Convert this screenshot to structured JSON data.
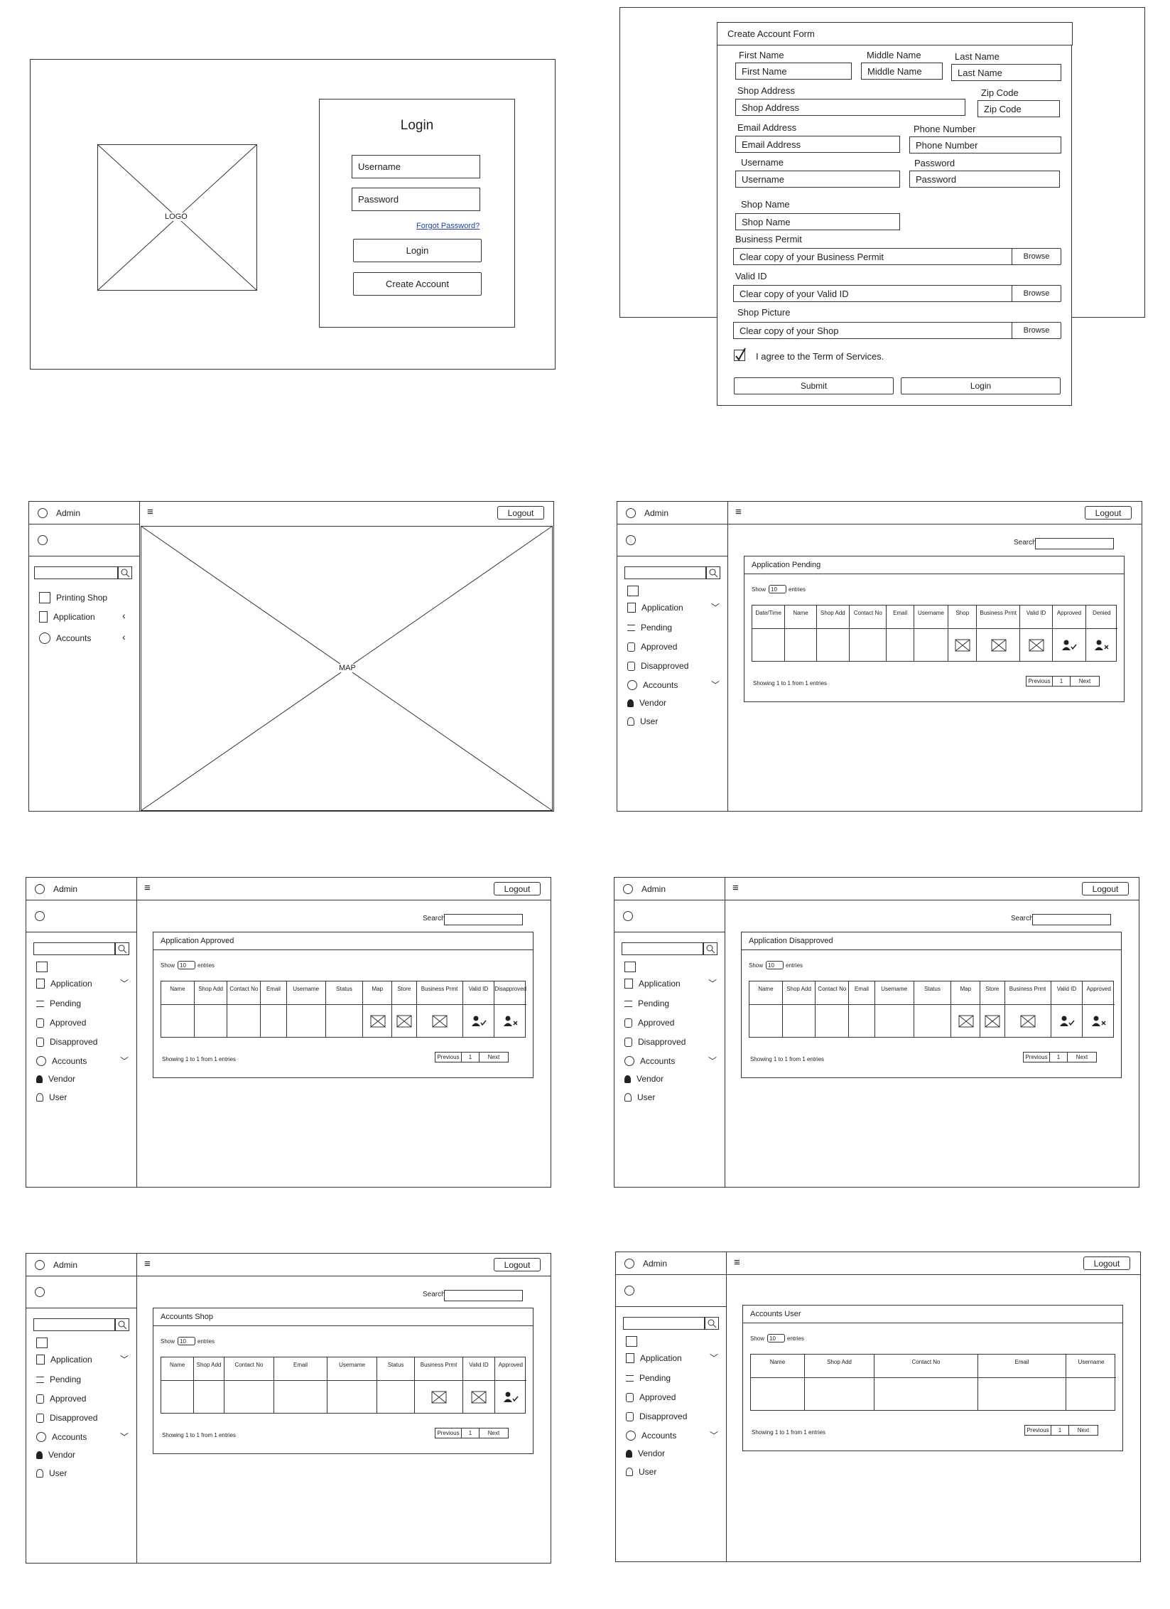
{
  "login": {
    "logo": "LOGO",
    "title": "Login",
    "username_placeholder": "Username",
    "password_placeholder": "Password",
    "forgot": "Forgot Password?",
    "login_btn": "Login",
    "create_btn": "Create Account"
  },
  "create_form": {
    "title": "Create Account Form",
    "first_name_label": "First Name",
    "first_name": "First Name",
    "middle_name_label": "Middle Name",
    "middle_name": "Middle Name",
    "last_name_label": "Last Name",
    "last_name": "Last Name",
    "shop_address_label": "Shop Address",
    "shop_address": "Shop Address",
    "zip_label": "Zip Code",
    "zip": "Zip Code",
    "email_label": "Email Address",
    "email": "Email Address",
    "phone_label": "Phone Number",
    "phone": "Phone Number",
    "username_label": "Username",
    "username": "Username",
    "password_label": "Password",
    "password": "Password",
    "shop_name_label": "Shop Name",
    "shop_name": "Shop Name",
    "permit_label": "Business Permit",
    "permit": "Clear copy of your Business Permit",
    "valid_id_label": "Valid ID",
    "valid_id": "Clear copy of your Valid ID",
    "shop_pic_label": "Shop Picture",
    "shop_pic": "Clear copy of your Shop",
    "browse": "Browse",
    "agree": "I agree to the Term of Services.",
    "submit": "Submit",
    "login": "Login"
  },
  "common": {
    "admin": "Admin",
    "logout": "Logout",
    "menu": "≡",
    "search_label": "Search",
    "show": "Show",
    "show_value": "10",
    "entries": "entries",
    "showing": "Showing 1  to 1 from 1 entries",
    "previous": "Previous",
    "page": "1",
    "next": "Next",
    "side_application": "Application",
    "side_pending": "Pending",
    "side_approved": "Approved",
    "side_disapproved": "Disapproved",
    "side_accounts": "Accounts",
    "side_vendor": "Vendor",
    "side_user": "User"
  },
  "map_screen": {
    "side_printing": "Printing Shop",
    "side_application": "Application",
    "side_accounts": "Accounts",
    "map": "MAP"
  },
  "pending": {
    "title": "Application Pending",
    "cols": [
      "Date/Time",
      "Name",
      "Shop Add",
      "Contact No",
      "Email",
      "Username",
      "Shop",
      "Business Prmt",
      "Valid ID",
      "Approved",
      "Denied"
    ]
  },
  "approved": {
    "title": "Application Approved",
    "cols": [
      "Name",
      "Shop Add",
      "Contact No",
      "Email",
      "Username",
      "Status",
      "Map",
      "Store",
      "Business Prmt",
      "Valid ID",
      "Disapproved"
    ]
  },
  "disapproved": {
    "title": "Application Disapproved",
    "cols": [
      "Name",
      "Shop Add",
      "Contact No",
      "Email",
      "Username",
      "Status",
      "Map",
      "Store",
      "Business Prmt",
      "Valid ID",
      "Approved"
    ]
  },
  "accounts_shop": {
    "title": "Accounts Shop",
    "cols": [
      "Name",
      "Shop Add",
      "Contact No",
      "Email",
      "Username",
      "Status",
      "Business Prmt",
      "Valid ID",
      "Approved"
    ]
  },
  "accounts_user": {
    "title": "Accounts User",
    "cols": [
      "Name",
      "Shop Add",
      "Contact No",
      "Email",
      "Username"
    ]
  }
}
